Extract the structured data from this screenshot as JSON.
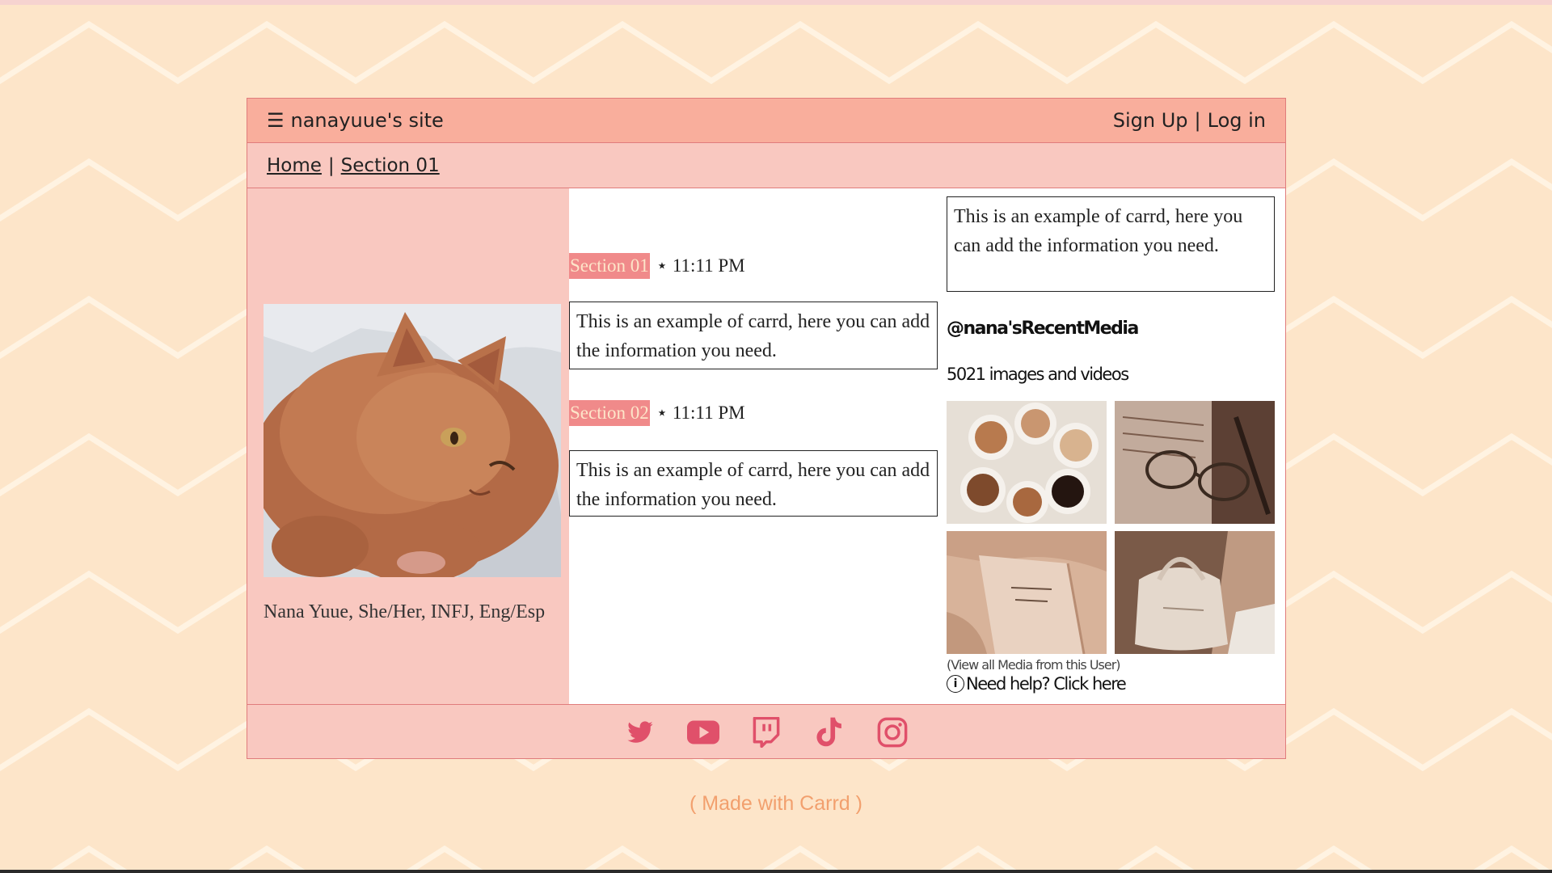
{
  "site": {
    "title": "nanayuue's site",
    "menu_glyph": "☰"
  },
  "auth": {
    "signup": "Sign Up",
    "separator": "|",
    "login": "Log in"
  },
  "breadcrumb": {
    "items": [
      "Home",
      "Section 01"
    ],
    "separator": "|"
  },
  "profile": {
    "bio": "Nana Yuue, She/Her, INFJ, Eng/Esp"
  },
  "sections": [
    {
      "tag": "Section 01",
      "time": "⋆ 11:11 PM",
      "text": "This is an example of carrd, here you can add the information you need."
    },
    {
      "tag": "Section 02",
      "time": "⋆ 11:11 PM",
      "text": "This is an example of carrd, here you can add the information you need."
    }
  ],
  "side_note": {
    "text": "This is an example of carrd, here you can add the information you need."
  },
  "media": {
    "handle": "@nana'sRecentMedia",
    "count": "5021 images and videos",
    "view_all": "(View all Media from this User)",
    "help": "Need help? Click here",
    "info_glyph": "i"
  },
  "social": [
    "twitter-icon",
    "youtube-icon",
    "twitch-icon",
    "tiktok-icon",
    "instagram-icon"
  ],
  "made_with": "( Made with Carrd )",
  "colors": {
    "background": "#fde5c9",
    "topbar": "#f9ae9c",
    "panel_pink": "#f9c8c0",
    "section_tag": "#f08a8a",
    "social_icon": "#e0506a",
    "made_with": "#f2a06e"
  }
}
